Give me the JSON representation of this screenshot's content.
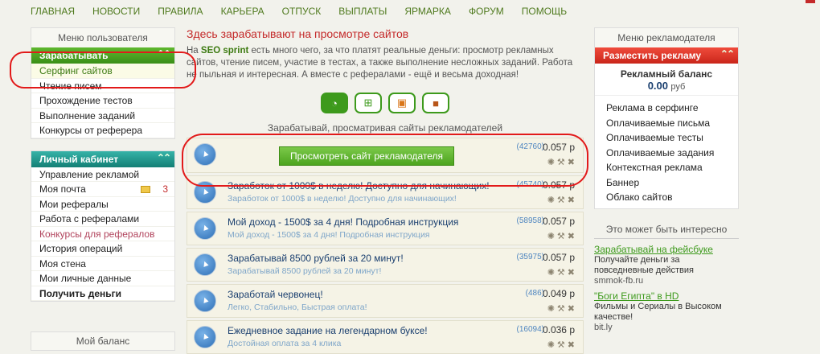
{
  "topnav": [
    "ГЛАВНАЯ",
    "НОВОСТИ",
    "ПРАВИЛА",
    "КАРЬЕРА",
    "ОТПУСК",
    "ВЫПЛАТЫ",
    "ЯРМАРКА",
    "ФОРУМ",
    "ПОМОЩЬ"
  ],
  "left": {
    "user_menu_title": "Меню пользователя",
    "earn_bar": "Зарабатывать",
    "earn_items": [
      "Серфинг сайтов",
      "Чтение писем",
      "Прохождение тестов",
      "Выполнение заданий",
      "Конкурсы от реферера"
    ],
    "cabinet_bar": "Личный кабинет",
    "cabinet_items": [
      "Управление рекламой",
      "Моя почта",
      "Мои рефералы",
      "Работа с рефералами",
      "Конкурсы для рефералов",
      "История операций",
      "Моя стена",
      "Мои личные данные",
      "Получить деньги"
    ],
    "mail_count": "3",
    "balance_title": "Мой баланс"
  },
  "main": {
    "heading": "Здесь зарабатывают на просмотре сайтов",
    "intro_pre": "На ",
    "intro_brand": "SEO sprint",
    "intro_post": " есть много чего, за что платят реальные деньги: просмотр рекламных сайтов, чтение писем, участие в тестах, а также выполнение несложных заданий. Работа не пыльная и интересная. А вместе с рефералами - ещё и весьма доходная!",
    "subtitle": "Зарабатывай, просматривая сайты рекламодателей",
    "view_button": "Просмотреть сайт рекламодателя",
    "first_views": "(42760)",
    "first_price": "0.057 р",
    "ads": [
      {
        "title": "Заработок от 1000$ в неделю! Доступно для начинающих!",
        "desc": "Заработок от 1000$ в неделю! Доступно для начинающих!",
        "views": "(45740)",
        "price": "0.057 р"
      },
      {
        "title": "Мой доход - 1500$ за 4 дня! Подробная инструкция",
        "desc": "Мой доход - 1500$ за 4 дня! Подробная инструкция",
        "views": "(58958)",
        "price": "0.057 р"
      },
      {
        "title": "Зарабатывай 8500 рублей за 20 минут!",
        "desc": "Зарабатывай 8500 рублей за 20 минут!",
        "views": "(35975)",
        "price": "0.057 р"
      },
      {
        "title": "Заработай червонец!",
        "desc": "Легко, Стабильно, Быстрая оплата!",
        "views": "(486)",
        "price": "0.049 р"
      },
      {
        "title": "Ежедневное задание на легендарном буксе!",
        "desc": "Достойная оплата за 4 клика",
        "views": "(16094)",
        "price": "0.036 р"
      }
    ]
  },
  "right": {
    "adv_menu_title": "Меню рекламодателя",
    "place_bar": "Разместить рекламу",
    "balance_label": "Рекламный баланс",
    "balance_value": "0.00",
    "balance_unit": "руб",
    "items": [
      "Реклама в серфинге",
      "Оплачиваемые письма",
      "Оплачиваемые тесты",
      "Оплачиваемые задания",
      "Контекстная реклама",
      "Баннер",
      "Облако сайтов"
    ],
    "interest_title": "Это может быть интересно",
    "promos": [
      {
        "title": "Зарабатывай на фейсбуке",
        "desc": "Получайте деньги за повседневные действия",
        "link": "smmok-fb.ru"
      },
      {
        "title": "\"Боги Египта\" в HD",
        "desc": "Фильмы и Сериалы в Высоком качестве!",
        "link": "bit.ly"
      }
    ]
  },
  "colors": {
    "accent_green": "#3d9a1c",
    "accent_red": "#c42a2a",
    "highlight_ring": "#e21a1a"
  }
}
